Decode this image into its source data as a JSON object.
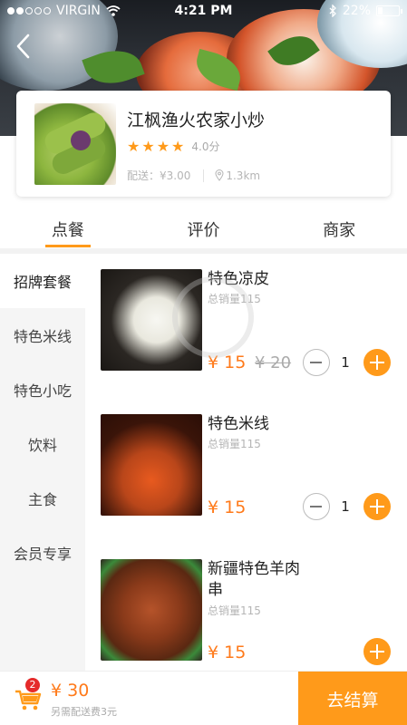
{
  "status_bar": {
    "carrier": "VIRGIN",
    "time": "4:21 PM",
    "battery_text": "22%",
    "signal_bars_filled": 2,
    "signal_bars_total": 5
  },
  "shop": {
    "name": "江枫渔火农家小炒",
    "rating_text": "4.0分",
    "stars_filled": 4,
    "delivery_fee": "配送：¥3.00",
    "distance": "1.3km"
  },
  "tabs": [
    {
      "label": "点餐",
      "active": true
    },
    {
      "label": "评价",
      "active": false
    },
    {
      "label": "商家",
      "active": false
    }
  ],
  "categories": [
    {
      "label": "招牌套餐",
      "active": true
    },
    {
      "label": "特色米线",
      "active": false
    },
    {
      "label": "特色小吃",
      "active": false
    },
    {
      "label": "饮料",
      "active": false
    },
    {
      "label": "主食",
      "active": false
    },
    {
      "label": "会员专享",
      "active": false
    }
  ],
  "items": [
    {
      "name": "特色凉皮",
      "sold": "总销量115",
      "price": "¥ 15",
      "old_price": "¥ 20",
      "qty": "1"
    },
    {
      "name": "特色米线",
      "sold": "总销量115",
      "price": "¥ 15",
      "old_price": "",
      "qty": "1"
    },
    {
      "name": "新疆特色羊肉串",
      "sold": "总销量115",
      "price": "¥ 15",
      "old_price": "",
      "qty": ""
    }
  ],
  "cart": {
    "count": "2",
    "total": "¥ 30",
    "extra_note": "另需配送费3元",
    "checkout_label": "去结算"
  },
  "colors": {
    "accent": "#ff9a1a",
    "price": "#ff7a1a",
    "badge": "#e52a2a"
  }
}
